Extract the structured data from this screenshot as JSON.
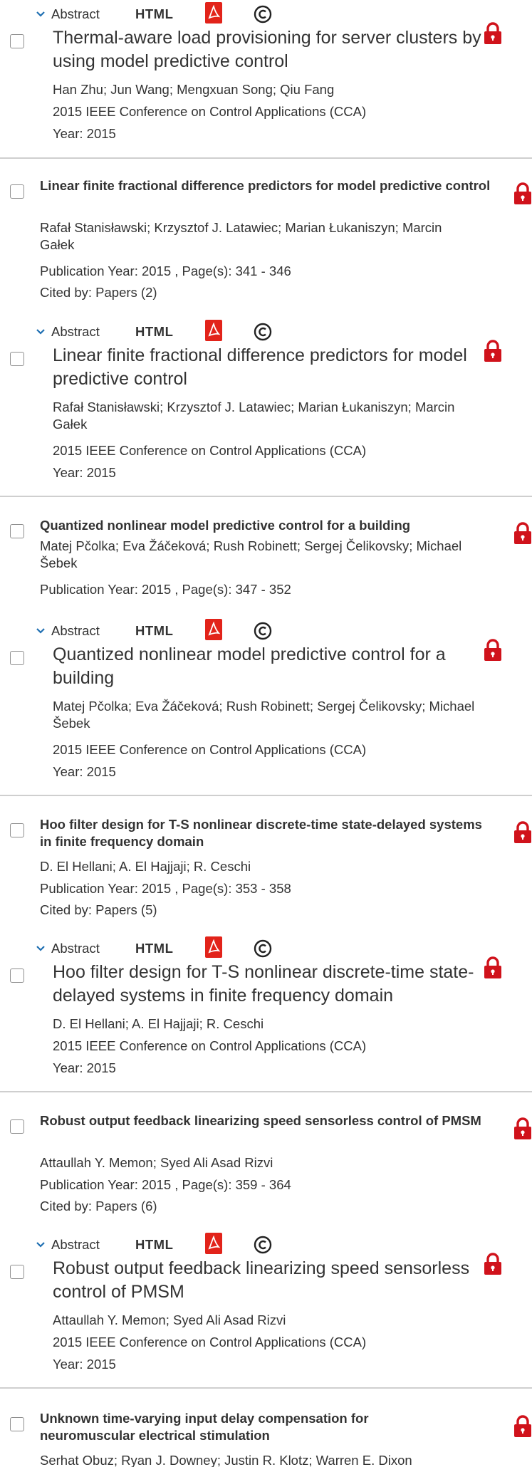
{
  "toolbar_labels": {
    "abstract": "Abstract",
    "html": "HTML"
  },
  "colors": {
    "lock": "#d0121b",
    "pdf": "#e2231a",
    "divider": "#cfcfcf",
    "text": "#333333"
  },
  "icons": [
    "chevron-down-icon",
    "pdf-icon",
    "copyright-icon",
    "lock-icon",
    "checkbox"
  ],
  "entries": [
    {
      "detail": {
        "title": "Thermal-aware load provisioning for server clusters by using model predictive control",
        "authors": "Han Zhu; Jun Wang; Mengxuan Song; Qiu Fang",
        "venue": "2015 IEEE Conference on Control Applications (CCA)",
        "year": "Year: 2015"
      }
    },
    {
      "summary": {
        "title": "Linear finite fractional difference predictors for model predictive control",
        "authors": "Rafał Stanisławski; Krzysztof J. Latawiec; Marian Łukaniszyn; Marcin Gałek",
        "publication": "Publication Year: 2015 , Page(s): 341  -  346",
        "cited": "Cited by: Papers (2)"
      },
      "detail": {
        "title": "Linear finite fractional difference predictors for model predictive control",
        "authors": "Rafał Stanisławski; Krzysztof J. Latawiec; Marian Łukaniszyn; Marcin Gałek",
        "venue": "2015 IEEE Conference on Control Applications (CCA)",
        "year": "Year: 2015"
      }
    },
    {
      "summary": {
        "title": "Quantized nonlinear model predictive control for a building",
        "authors": "Matej Pčolka; Eva Žáčeková; Rush Robinett; Sergej Čelikovsky; Michael Šebek",
        "publication": "Publication Year: 2015 , Page(s): 347  -  352"
      },
      "detail": {
        "title": "Quantized nonlinear model predictive control for a building",
        "authors": "Matej Pčolka; Eva Žáčeková; Rush Robinett; Sergej Čelikovsky; Michael Šebek",
        "venue": "2015 IEEE Conference on Control Applications (CCA)",
        "year": "Year: 2015"
      }
    },
    {
      "summary": {
        "title": "Hoo filter design for T-S nonlinear discrete-time state-delayed systems in finite frequency domain",
        "authors": "D. El Hellani; A. El Hajjaji; R. Ceschi",
        "publication": "Publication Year: 2015 , Page(s): 353  -  358",
        "cited": "Cited by: Papers (5)"
      },
      "detail": {
        "title": "Hoo filter design for T-S nonlinear discrete-time state-delayed systems in finite frequency domain",
        "authors": "D. El Hellani; A. El Hajjaji; R. Ceschi",
        "venue": "2015 IEEE Conference on Control Applications (CCA)",
        "year": "Year: 2015"
      }
    },
    {
      "summary": {
        "title": "Robust output feedback linearizing speed sensorless control of PMSM",
        "authors": "Attaullah Y. Memon; Syed Ali Asad Rizvi",
        "publication": "Publication Year: 2015 , Page(s): 359  -  364",
        "cited": "Cited by: Papers (6)"
      },
      "detail": {
        "title": "Robust output feedback linearizing speed sensorless control of PMSM",
        "authors": "Attaullah Y. Memon; Syed Ali Asad Rizvi",
        "venue": "2015 IEEE Conference on Control Applications (CCA)",
        "year": "Year: 2015"
      }
    },
    {
      "summary": {
        "title": "Unknown time-varying input delay compensation for neuromuscular electrical stimulation",
        "authors": "Serhat Obuz; Ryan J. Downey; Justin R. Klotz; Warren E. Dixon"
      }
    }
  ]
}
